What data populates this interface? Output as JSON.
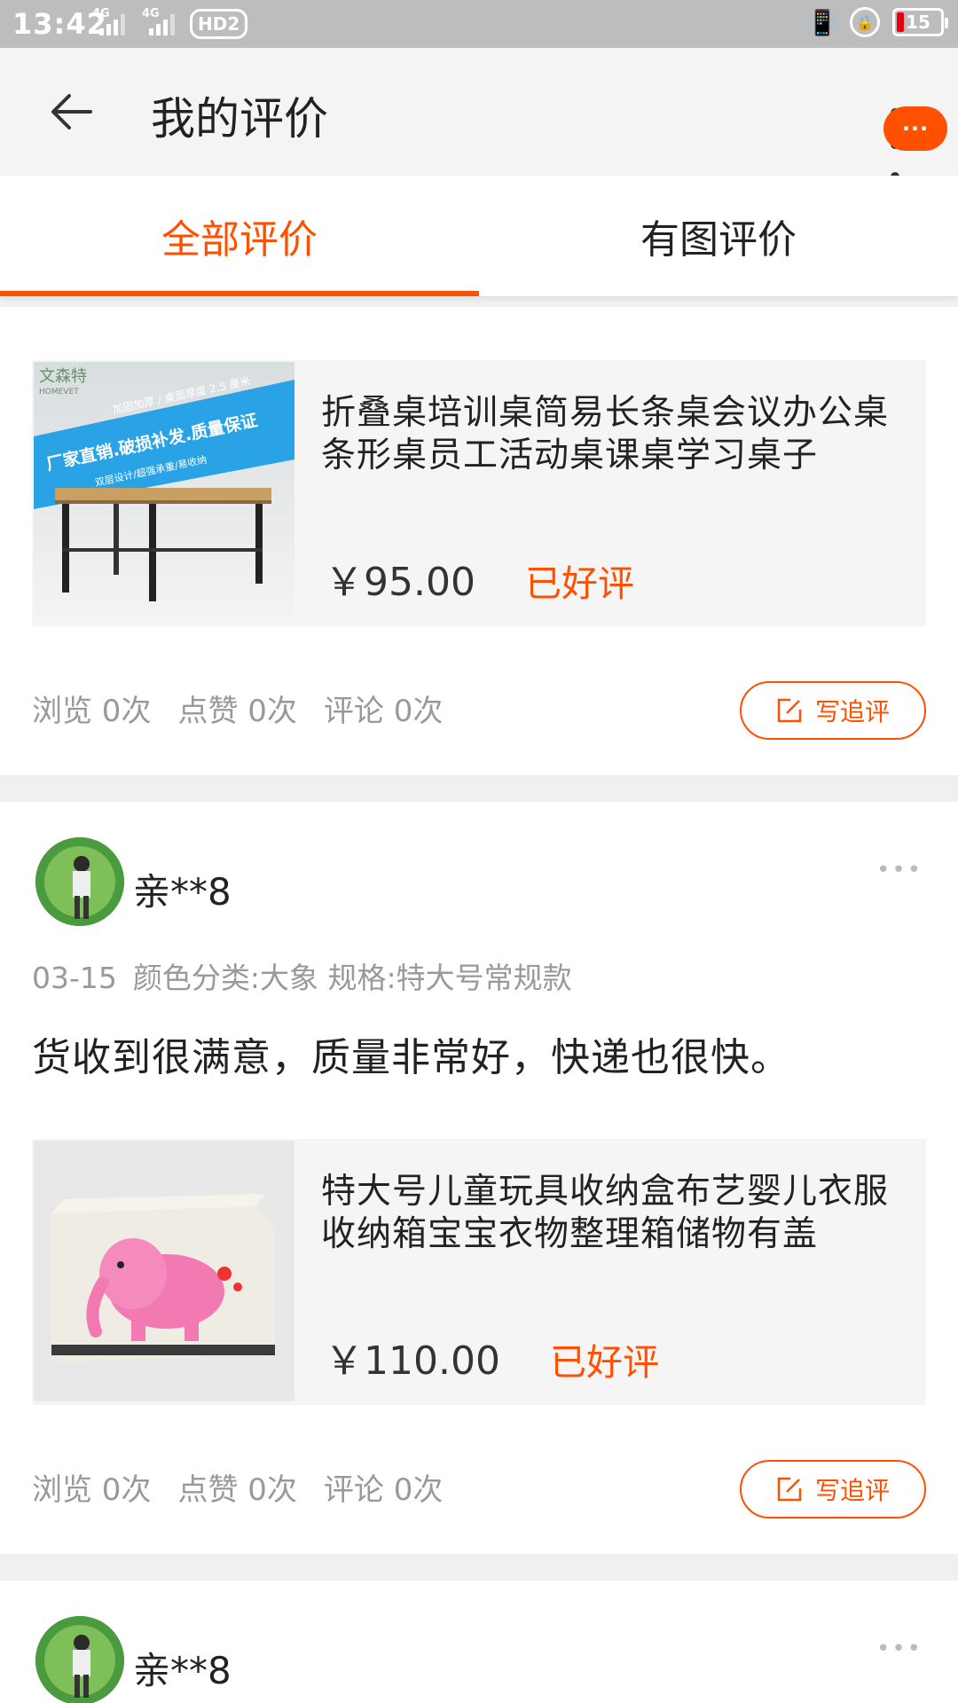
{
  "status_bar": {
    "time": "13:42",
    "net1": "4G",
    "net2": "4G",
    "hd": "HD2",
    "battery": "15"
  },
  "header": {
    "title": "我的评价",
    "bubble_text": "···"
  },
  "tabs": [
    {
      "label": "全部评价",
      "active": true
    },
    {
      "label": "有图评价",
      "active": false
    }
  ],
  "reviews": [
    {
      "product": {
        "name": "折叠桌培训桌简易长条桌会议办公桌条形桌员工活动桌课桌学习桌子",
        "price": "￥95.00",
        "status": "已好评"
      },
      "stats": {
        "views": "浏览 0次",
        "likes": "点赞 0次",
        "comments": "评论 0次"
      },
      "followup_label": "写追评"
    },
    {
      "user": "亲**8",
      "date": "03-15",
      "sku": "颜色分类:大象 规格:特大号常规款",
      "text": "货收到很满意，质量非常好，快递也很快。",
      "product": {
        "name": "特大号儿童玩具收纳盒布艺婴儿衣服收纳箱宝宝衣物整理箱储物有盖",
        "price": "￥110.00",
        "status": "已好评"
      },
      "stats": {
        "views": "浏览 0次",
        "likes": "点赞 0次",
        "comments": "评论 0次"
      },
      "followup_label": "写追评"
    },
    {
      "user": "亲**8"
    }
  ],
  "thumb1": {
    "brand": "文森特",
    "brand_en": "HOMEVET",
    "line1": "加固加厚 / 桌面厚度 2.5 厘米",
    "line2": "厂家直销.破损补发.质量保证",
    "line3": "双层设计/超强承重/易收纳"
  },
  "colors": {
    "accent": "#ff5000",
    "elephant": "#f279b1"
  }
}
